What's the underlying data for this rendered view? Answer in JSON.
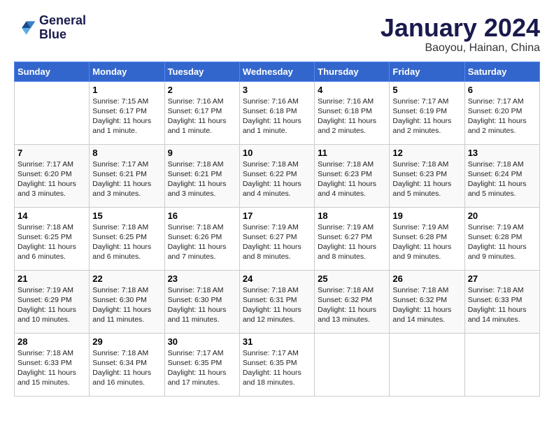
{
  "header": {
    "logo_line1": "General",
    "logo_line2": "Blue",
    "month_year": "January 2024",
    "location": "Baoyou, Hainan, China"
  },
  "days_of_week": [
    "Sunday",
    "Monday",
    "Tuesday",
    "Wednesday",
    "Thursday",
    "Friday",
    "Saturday"
  ],
  "weeks": [
    [
      {
        "day": "",
        "info": ""
      },
      {
        "day": "1",
        "info": "Sunrise: 7:15 AM\nSunset: 6:17 PM\nDaylight: 11 hours\nand 1 minute."
      },
      {
        "day": "2",
        "info": "Sunrise: 7:16 AM\nSunset: 6:17 PM\nDaylight: 11 hours\nand 1 minute."
      },
      {
        "day": "3",
        "info": "Sunrise: 7:16 AM\nSunset: 6:18 PM\nDaylight: 11 hours\nand 1 minute."
      },
      {
        "day": "4",
        "info": "Sunrise: 7:16 AM\nSunset: 6:18 PM\nDaylight: 11 hours\nand 2 minutes."
      },
      {
        "day": "5",
        "info": "Sunrise: 7:17 AM\nSunset: 6:19 PM\nDaylight: 11 hours\nand 2 minutes."
      },
      {
        "day": "6",
        "info": "Sunrise: 7:17 AM\nSunset: 6:20 PM\nDaylight: 11 hours\nand 2 minutes."
      }
    ],
    [
      {
        "day": "7",
        "info": "Sunrise: 7:17 AM\nSunset: 6:20 PM\nDaylight: 11 hours\nand 3 minutes."
      },
      {
        "day": "8",
        "info": "Sunrise: 7:17 AM\nSunset: 6:21 PM\nDaylight: 11 hours\nand 3 minutes."
      },
      {
        "day": "9",
        "info": "Sunrise: 7:18 AM\nSunset: 6:21 PM\nDaylight: 11 hours\nand 3 minutes."
      },
      {
        "day": "10",
        "info": "Sunrise: 7:18 AM\nSunset: 6:22 PM\nDaylight: 11 hours\nand 4 minutes."
      },
      {
        "day": "11",
        "info": "Sunrise: 7:18 AM\nSunset: 6:23 PM\nDaylight: 11 hours\nand 4 minutes."
      },
      {
        "day": "12",
        "info": "Sunrise: 7:18 AM\nSunset: 6:23 PM\nDaylight: 11 hours\nand 5 minutes."
      },
      {
        "day": "13",
        "info": "Sunrise: 7:18 AM\nSunset: 6:24 PM\nDaylight: 11 hours\nand 5 minutes."
      }
    ],
    [
      {
        "day": "14",
        "info": "Sunrise: 7:18 AM\nSunset: 6:25 PM\nDaylight: 11 hours\nand 6 minutes."
      },
      {
        "day": "15",
        "info": "Sunrise: 7:18 AM\nSunset: 6:25 PM\nDaylight: 11 hours\nand 6 minutes."
      },
      {
        "day": "16",
        "info": "Sunrise: 7:18 AM\nSunset: 6:26 PM\nDaylight: 11 hours\nand 7 minutes."
      },
      {
        "day": "17",
        "info": "Sunrise: 7:19 AM\nSunset: 6:27 PM\nDaylight: 11 hours\nand 8 minutes."
      },
      {
        "day": "18",
        "info": "Sunrise: 7:19 AM\nSunset: 6:27 PM\nDaylight: 11 hours\nand 8 minutes."
      },
      {
        "day": "19",
        "info": "Sunrise: 7:19 AM\nSunset: 6:28 PM\nDaylight: 11 hours\nand 9 minutes."
      },
      {
        "day": "20",
        "info": "Sunrise: 7:19 AM\nSunset: 6:28 PM\nDaylight: 11 hours\nand 9 minutes."
      }
    ],
    [
      {
        "day": "21",
        "info": "Sunrise: 7:19 AM\nSunset: 6:29 PM\nDaylight: 11 hours\nand 10 minutes."
      },
      {
        "day": "22",
        "info": "Sunrise: 7:18 AM\nSunset: 6:30 PM\nDaylight: 11 hours\nand 11 minutes."
      },
      {
        "day": "23",
        "info": "Sunrise: 7:18 AM\nSunset: 6:30 PM\nDaylight: 11 hours\nand 11 minutes."
      },
      {
        "day": "24",
        "info": "Sunrise: 7:18 AM\nSunset: 6:31 PM\nDaylight: 11 hours\nand 12 minutes."
      },
      {
        "day": "25",
        "info": "Sunrise: 7:18 AM\nSunset: 6:32 PM\nDaylight: 11 hours\nand 13 minutes."
      },
      {
        "day": "26",
        "info": "Sunrise: 7:18 AM\nSunset: 6:32 PM\nDaylight: 11 hours\nand 14 minutes."
      },
      {
        "day": "27",
        "info": "Sunrise: 7:18 AM\nSunset: 6:33 PM\nDaylight: 11 hours\nand 14 minutes."
      }
    ],
    [
      {
        "day": "28",
        "info": "Sunrise: 7:18 AM\nSunset: 6:33 PM\nDaylight: 11 hours\nand 15 minutes."
      },
      {
        "day": "29",
        "info": "Sunrise: 7:18 AM\nSunset: 6:34 PM\nDaylight: 11 hours\nand 16 minutes."
      },
      {
        "day": "30",
        "info": "Sunrise: 7:17 AM\nSunset: 6:35 PM\nDaylight: 11 hours\nand 17 minutes."
      },
      {
        "day": "31",
        "info": "Sunrise: 7:17 AM\nSunset: 6:35 PM\nDaylight: 11 hours\nand 18 minutes."
      },
      {
        "day": "",
        "info": ""
      },
      {
        "day": "",
        "info": ""
      },
      {
        "day": "",
        "info": ""
      }
    ]
  ]
}
